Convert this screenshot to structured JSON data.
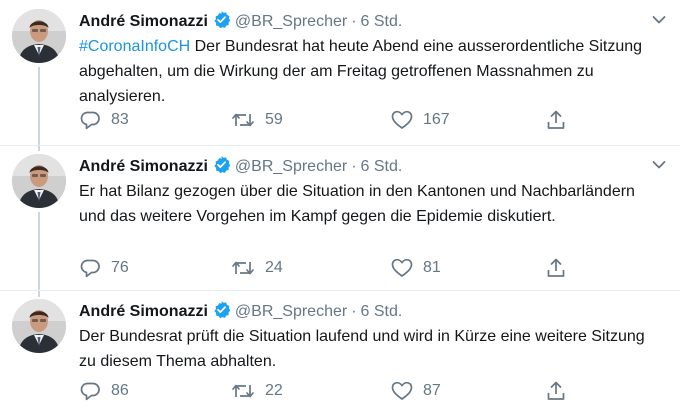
{
  "tweets": [
    {
      "author": "André Simonazzi",
      "handle": "@BR_Sprecher",
      "separator": "·",
      "time": "6 Std.",
      "hashtag": "#CoronaInfoCH",
      "text": " Der Bundesrat hat heute Abend eine ausserordentliche Sitzung abgehalten, um die Wirkung der am Freitag getroffenen Massnahmen zu analysieren.",
      "replies": "83",
      "retweets": "59",
      "likes": "167"
    },
    {
      "author": "André Simonazzi",
      "handle": "@BR_Sprecher",
      "separator": "·",
      "time": "6 Std.",
      "text": "Er hat Bilanz gezogen über die Situation in den Kantonen und Nachbarländern und das weitere Vorgehen im Kampf gegen die Epidemie diskutiert.",
      "replies": "76",
      "retweets": "24",
      "likes": "81"
    },
    {
      "author": "André Simonazzi",
      "handle": "@BR_Sprecher",
      "separator": "·",
      "time": "6 Std.",
      "text": "Der Bundesrat prüft die Situation laufend und wird in Kürze eine weitere Sitzung zu diesem Thema abhalten.",
      "replies": "86",
      "retweets": "22",
      "likes": "87"
    }
  ],
  "icons": {
    "verified": "verified-badge-icon",
    "reply": "reply-icon",
    "retweet": "retweet-icon",
    "like": "heart-icon",
    "share": "share-icon",
    "more": "chevron-down-icon"
  },
  "colors": {
    "accent": "#1da1f2",
    "hashtag": "#1b95e0",
    "muted": "#657786",
    "divider": "#e6ecf0"
  }
}
